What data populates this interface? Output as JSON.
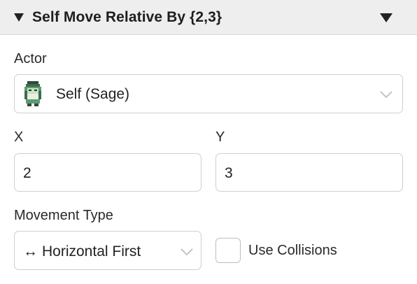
{
  "header": {
    "title": "Self Move Relative By {2,3}",
    "collapse_icon": "triangle-down-icon",
    "menu_icon": "triangle-down-icon"
  },
  "actor": {
    "label": "Actor",
    "value": "Self (Sage)",
    "icon": "sage-sprite-icon"
  },
  "x": {
    "label": "X",
    "value": "2"
  },
  "y": {
    "label": "Y",
    "value": "3"
  },
  "movement": {
    "label": "Movement Type",
    "arrow": "↔",
    "value": "Horizontal First"
  },
  "collisions": {
    "label": "Use Collisions",
    "checked": false
  }
}
